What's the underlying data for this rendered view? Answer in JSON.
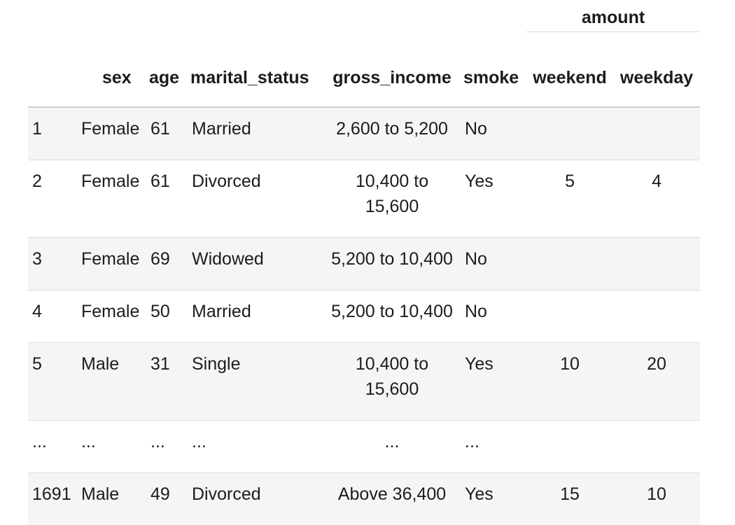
{
  "table": {
    "group_header": "amount",
    "columns": [
      "",
      "sex",
      "age",
      "marital_status",
      "gross_income",
      "smoke",
      "weekend",
      "weekday"
    ],
    "rows": [
      {
        "index": "1",
        "sex": "Female",
        "age": "61",
        "marital_status": "Married",
        "gross_income": "2,600 to 5,200",
        "smoke": "No",
        "weekend": "",
        "weekday": ""
      },
      {
        "index": "2",
        "sex": "Female",
        "age": "61",
        "marital_status": "Divorced",
        "gross_income": "10,400 to 15,600",
        "smoke": "Yes",
        "weekend": "5",
        "weekday": "4"
      },
      {
        "index": "3",
        "sex": "Female",
        "age": "69",
        "marital_status": "Widowed",
        "gross_income": "5,200 to 10,400",
        "smoke": "No",
        "weekend": "",
        "weekday": ""
      },
      {
        "index": "4",
        "sex": "Female",
        "age": "50",
        "marital_status": "Married",
        "gross_income": "5,200 to 10,400",
        "smoke": "No",
        "weekend": "",
        "weekday": ""
      },
      {
        "index": "5",
        "sex": "Male",
        "age": "31",
        "marital_status": "Single",
        "gross_income": "10,400 to 15,600",
        "smoke": "Yes",
        "weekend": "10",
        "weekday": "20"
      },
      {
        "index": "...",
        "sex": "...",
        "age": "...",
        "marital_status": "...",
        "gross_income": "...",
        "smoke": "...",
        "weekend": "",
        "weekday": ""
      },
      {
        "index": "1691",
        "sex": "Male",
        "age": "49",
        "marital_status": "Divorced",
        "gross_income": "Above 36,400",
        "smoke": "Yes",
        "weekend": "15",
        "weekday": "10"
      }
    ]
  }
}
